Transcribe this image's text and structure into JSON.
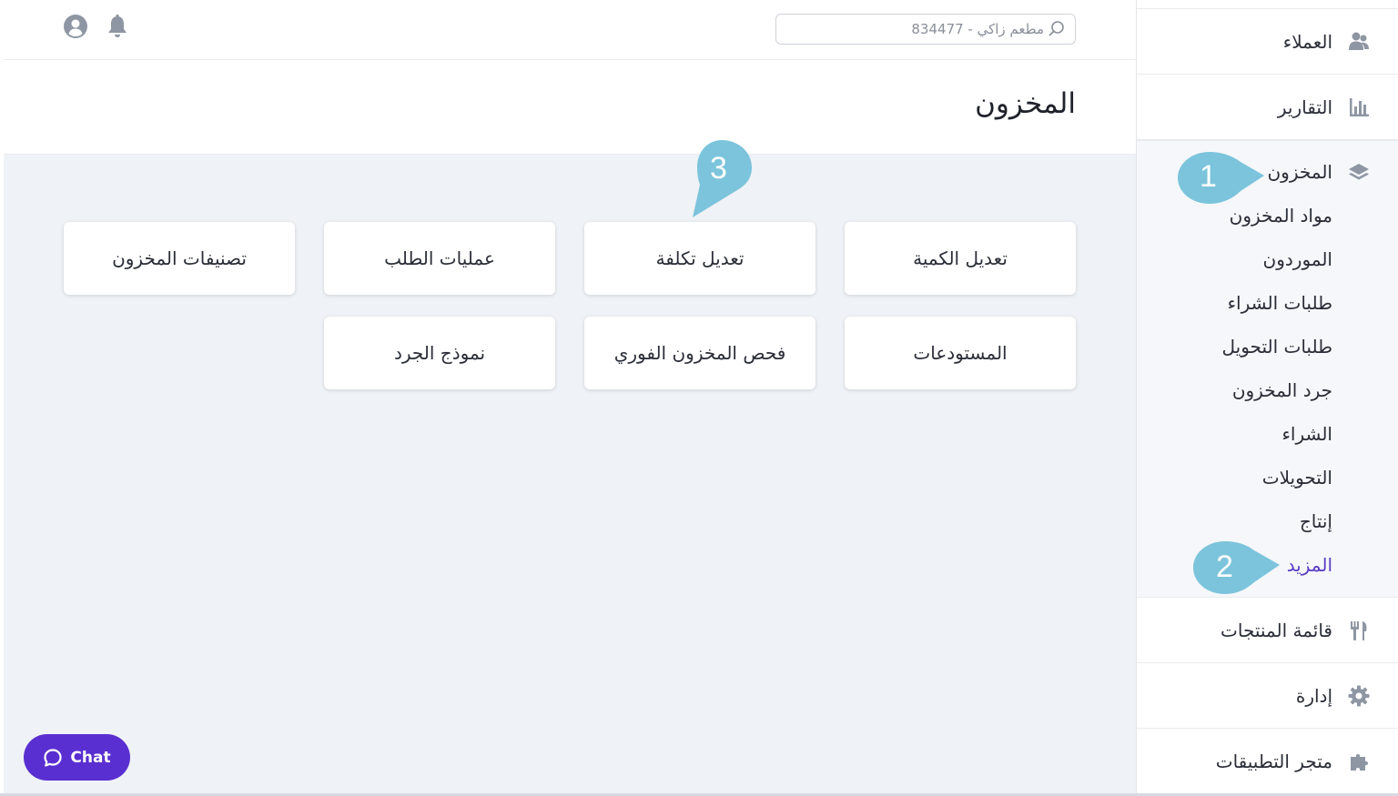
{
  "topbar": {
    "search_placeholder": "مطعم زاكي - 834477",
    "icons": [
      "search-icon",
      "bell-icon",
      "user-avatar-icon"
    ]
  },
  "page": {
    "title": "المخزون"
  },
  "sidebar": {
    "items_top": [
      {
        "label": "العملاء",
        "icon": "customers-icon"
      },
      {
        "label": "التقارير",
        "icon": "bar-chart-icon"
      }
    ],
    "group": {
      "label": "المخزون",
      "icon": "layers-icon",
      "sub_items": [
        {
          "label": "مواد المخزون",
          "active": false
        },
        {
          "label": "الموردون",
          "active": false
        },
        {
          "label": "طلبات الشراء",
          "active": false
        },
        {
          "label": "طلبات التحويل",
          "active": false
        },
        {
          "label": "جرد المخزون",
          "active": false
        },
        {
          "label": "الشراء",
          "active": false
        },
        {
          "label": "التحويلات",
          "active": false
        },
        {
          "label": "إنتاج",
          "active": false
        },
        {
          "label": "المزيد",
          "active": true
        }
      ]
    },
    "items_bottom": [
      {
        "label": "قائمة المنتجات",
        "icon": "fork-knife-icon"
      },
      {
        "label": "إدارة",
        "icon": "gear-icon"
      },
      {
        "label": "متجر التطبيقات",
        "icon": "puzzle-icon"
      }
    ]
  },
  "cards": [
    {
      "label": "تعديل الكمية"
    },
    {
      "label": "تعديل تكلفة"
    },
    {
      "label": "عمليات الطلب"
    },
    {
      "label": "تصنيفات المخزون"
    },
    {
      "label": "المستودعات"
    },
    {
      "label": "فحص المخزون الفوري"
    },
    {
      "label": "نموذج الجرد"
    }
  ],
  "chat": {
    "label": "Chat"
  },
  "markers": [
    {
      "number": "1"
    },
    {
      "number": "2"
    },
    {
      "number": "3"
    }
  ],
  "colors": {
    "accent": "#5a2fd1",
    "active_link": "#5b3cc4",
    "marker": "#7cc4dc",
    "icon_gray": "#8e96a3",
    "main_bg": "#eff2f6"
  }
}
